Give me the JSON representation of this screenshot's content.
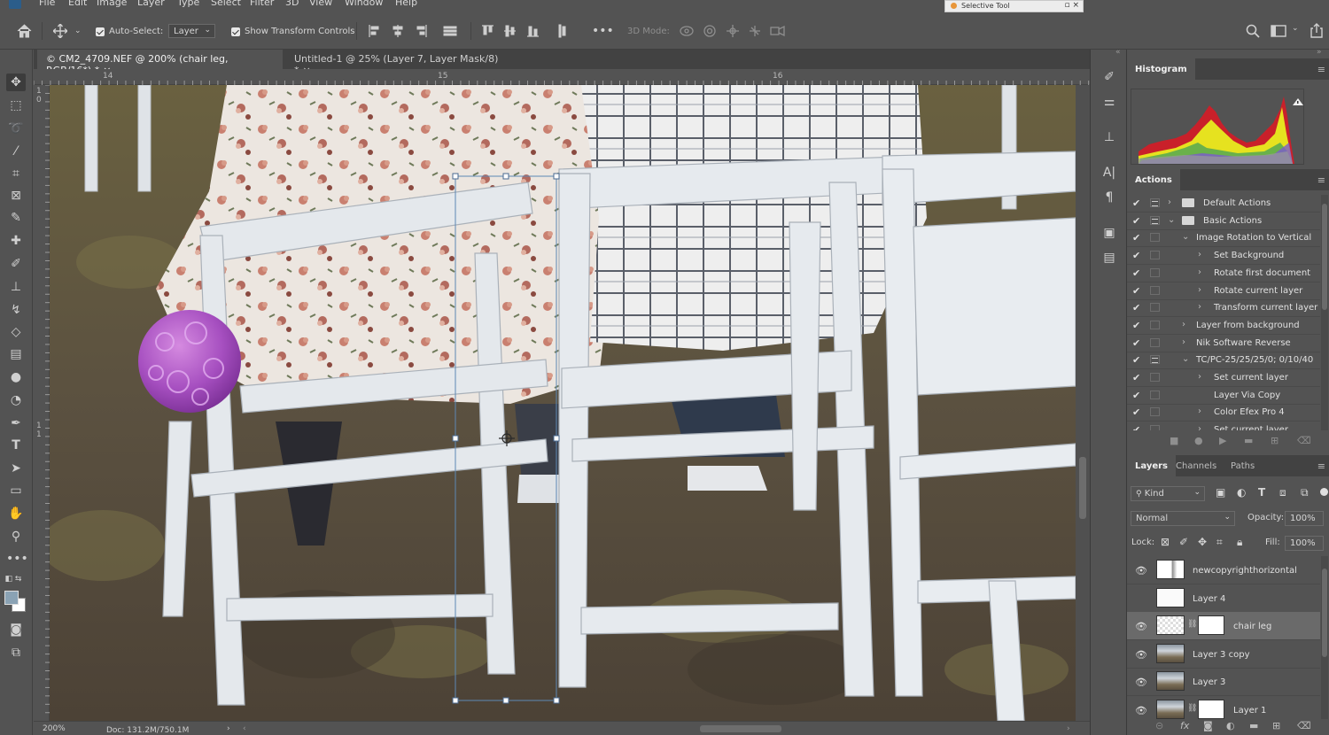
{
  "menu": {
    "items": [
      "File",
      "Edit",
      "Image",
      "Layer",
      "Type",
      "Select",
      "Filter",
      "3D",
      "View",
      "Window",
      "Help"
    ]
  },
  "floating_panel": {
    "title": "Selective Tool"
  },
  "options_bar": {
    "auto_select_label": "Auto-Select:",
    "auto_select_checked": true,
    "auto_select_target": "Layer",
    "show_transform_label": "Show Transform Controls",
    "show_transform_checked": true,
    "three_d_label": "3D Mode:"
  },
  "document_tabs": [
    {
      "label": "© CM2_4709.NEF @ 200% (chair leg, RGB/16*) *",
      "active": true
    },
    {
      "label": "Untitled-1 @ 25% (Layer 7, Layer Mask/8) *",
      "active": false
    }
  ],
  "rulers": {
    "top": [
      "14",
      "15",
      "16"
    ],
    "left": [
      "1",
      "0",
      "1",
      "1"
    ]
  },
  "status": {
    "zoom": "200%",
    "doc": "Doc: 131.2M/750.1M"
  },
  "histogram": {
    "title": "Histogram",
    "warning": true
  },
  "actions": {
    "title": "Actions",
    "rows": [
      {
        "label": "Default Actions",
        "level": 0,
        "type": "set",
        "expanded": false,
        "dialog": true
      },
      {
        "label": "Basic Actions",
        "level": 0,
        "type": "set",
        "expanded": true,
        "dialog": true
      },
      {
        "label": "Image Rotation to Vertical",
        "level": 1,
        "type": "action",
        "expanded": true,
        "dialog": false
      },
      {
        "label": "Set Background",
        "level": 2,
        "type": "step",
        "expanded": false,
        "dialog": false
      },
      {
        "label": "Rotate first document",
        "level": 2,
        "type": "step",
        "expanded": false,
        "dialog": false
      },
      {
        "label": "Rotate current layer",
        "level": 2,
        "type": "step",
        "expanded": false,
        "dialog": false
      },
      {
        "label": "Transform current layer",
        "level": 2,
        "type": "step",
        "expanded": false,
        "dialog": false
      },
      {
        "label": "Layer from background",
        "level": 1,
        "type": "action",
        "expanded": false,
        "dialog": false
      },
      {
        "label": "Nik Software Reverse",
        "level": 1,
        "type": "action",
        "expanded": false,
        "dialog": false
      },
      {
        "label": "TC/PC-25/25/25/0; 0/10/40",
        "level": 1,
        "type": "action",
        "expanded": true,
        "dialog": true
      },
      {
        "label": "Set current layer",
        "level": 2,
        "type": "step",
        "expanded": false,
        "dialog": false
      },
      {
        "label": "Layer Via Copy",
        "level": 2,
        "type": "step-noexp",
        "expanded": false,
        "dialog": false
      },
      {
        "label": "Color Efex Pro 4",
        "level": 2,
        "type": "step",
        "expanded": false,
        "dialog": false
      },
      {
        "label": "Set current layer",
        "level": 2,
        "type": "step",
        "expanded": false,
        "dialog": false
      }
    ]
  },
  "layers_panel": {
    "tabs": [
      "Layers",
      "Channels",
      "Paths"
    ],
    "filter_kind": "Kind",
    "blend_mode": "Normal",
    "opacity_label": "Opacity:",
    "opacity_value": "100%",
    "lock_label": "Lock:",
    "fill_label": "Fill:",
    "fill_value": "100%",
    "layers": [
      {
        "name": "newcopyrighthorizontal",
        "visible": true,
        "thumb": "text",
        "mask": false,
        "selected": false
      },
      {
        "name": "Layer 4",
        "visible": false,
        "thumb": "blank",
        "mask": false,
        "selected": false
      },
      {
        "name": "chair leg",
        "visible": true,
        "thumb": "transparent",
        "mask": true,
        "selected": true
      },
      {
        "name": "Layer 3 copy",
        "visible": true,
        "thumb": "photo",
        "mask": false,
        "selected": false
      },
      {
        "name": "Layer 3",
        "visible": true,
        "thumb": "photo",
        "mask": false,
        "selected": false
      },
      {
        "name": "Layer 1",
        "visible": true,
        "thumb": "photo",
        "mask": true,
        "selected": false
      }
    ]
  }
}
